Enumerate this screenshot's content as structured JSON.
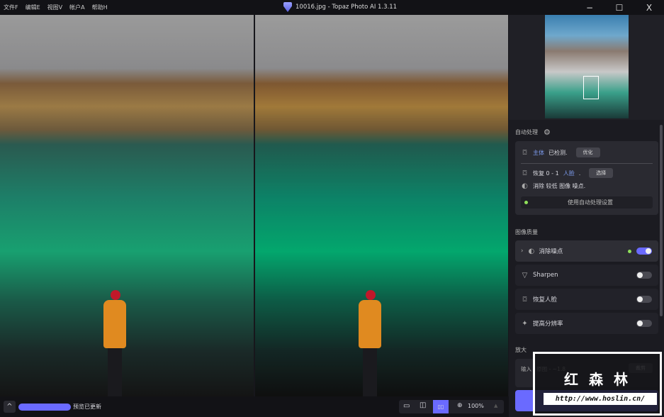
{
  "menu": [
    "文件F",
    "编辑E",
    "视图V",
    "帐户A",
    "帮助H"
  ],
  "window_title": "10016.jpg - Topaz Photo AI 1.3.11",
  "window_controls": {
    "minimize": "−",
    "maximize": "☐",
    "close": "X"
  },
  "auto": {
    "header": "自动处理",
    "subject": {
      "name": "主体",
      "text": "已检测.",
      "button": "优化"
    },
    "face": {
      "prefix": "恢复 0 - 1",
      "name": "人脸",
      "suffix": ".",
      "button": "选择"
    },
    "noise": "消除 较低 图像 噪点.",
    "apply": "使用自动处理设置"
  },
  "quality": {
    "header": "图像质量",
    "items": [
      {
        "label": "消除噪点",
        "on": true
      },
      {
        "label": "Sharpen",
        "on": false
      },
      {
        "label": "恢复人脸",
        "on": false
      },
      {
        "label": "提高分辨率",
        "on": false
      }
    ]
  },
  "upscale": {
    "header": "放大",
    "input": "输入 | 原图 - ~1.8",
    "crop": "裁剪"
  },
  "bottom": {
    "status": "预览已更新",
    "zoom": "100%",
    "progress": 1.0
  },
  "watermark": {
    "title": "红 森 林",
    "url": "http://www.hoslin.cn/"
  },
  "colors": {
    "accent": "#6a6aff",
    "active_dot": "#8fe05a"
  }
}
